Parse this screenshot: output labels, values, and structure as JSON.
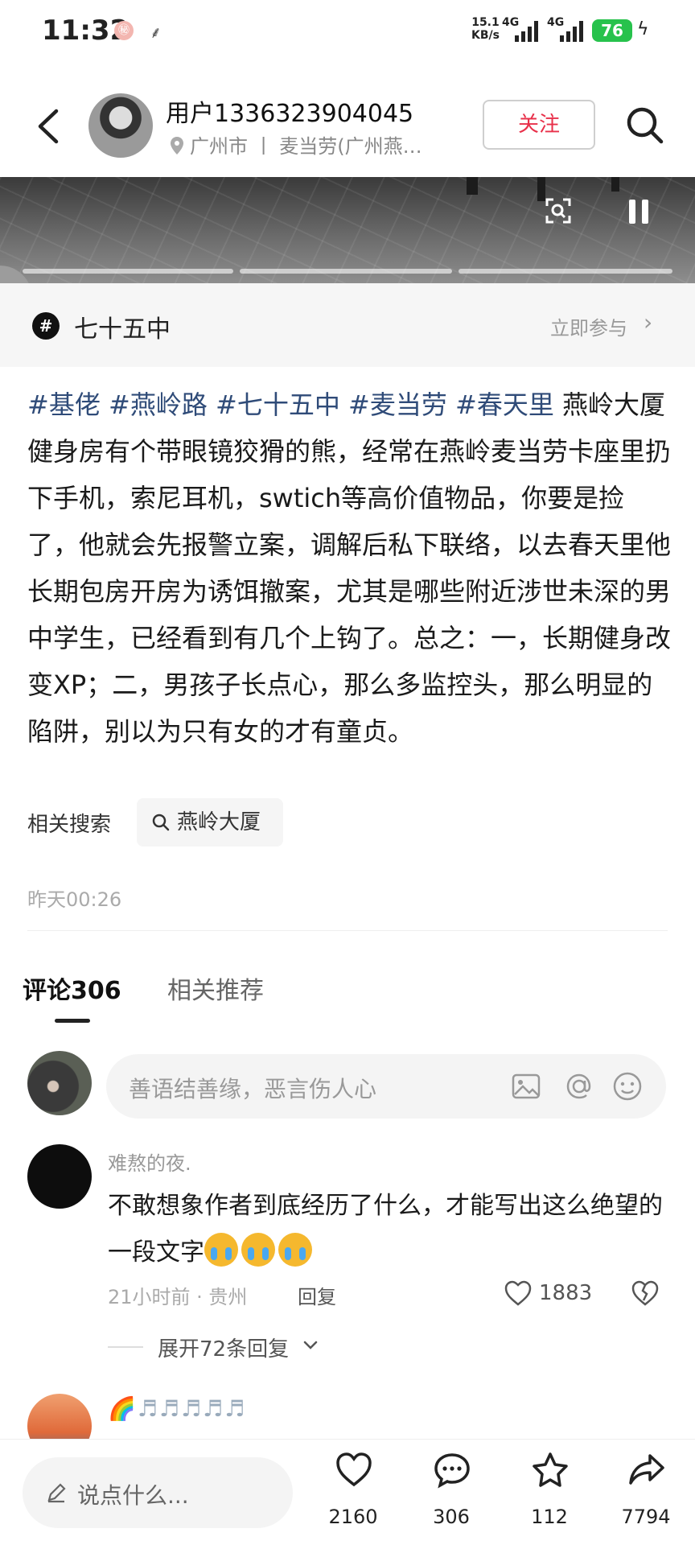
{
  "status_bar": {
    "time": "11:32",
    "net_speed_value": "15.1",
    "net_speed_unit": "KB/s",
    "signal1": "4G",
    "signal2": "4G",
    "battery": "76"
  },
  "header": {
    "username": "用户1336323904045",
    "location": "广州市 丨 麦当劳(广州燕…",
    "follow_label": "关注"
  },
  "topic": {
    "name": "七十五中",
    "join_label": "立即参与"
  },
  "post": {
    "hashtags": [
      "#基佬",
      "#燕岭路",
      "#七十五中",
      "#麦当劳",
      "#春天里"
    ],
    "body": "燕岭大厦健身房有个带眼镜狡猾的熊，经常在燕岭麦当劳卡座里扔下手机，索尼耳机，swtich等高价值物品，你要是捡了，他就会先报警立案，调解后私下联络，以去春天里他长期包房开房为诱饵撤案，尤其是哪些附近涉世未深的男中学生，已经看到有几个上钩了。总之：一，长期健身改变XP；二，男孩子长点心，那么多监控头，那么明显的陷阱，别以为只有女的才有童贞。",
    "related_label": "相关搜索",
    "related_query": "燕岭大厦",
    "time": "昨天00:26"
  },
  "tabs": {
    "comments": "评论306",
    "related": "相关推荐"
  },
  "comment_input": {
    "placeholder": "善语结善缘，恶言伤人心"
  },
  "comment": {
    "author": "难熬的夜.",
    "text": "不敢想象作者到底经历了什么，才能写出这么绝望的一段文字",
    "meta": "21小时前 · 贵州",
    "reply_label": "回复",
    "likes": "1883",
    "expand_label": "展开72条回复"
  },
  "next_comment": {
    "author": "🌈♬♬♬♬♬"
  },
  "bottom_bar": {
    "say_placeholder": "说点什么...",
    "likes": "2160",
    "comments": "306",
    "favorites": "112",
    "shares": "7794"
  }
}
